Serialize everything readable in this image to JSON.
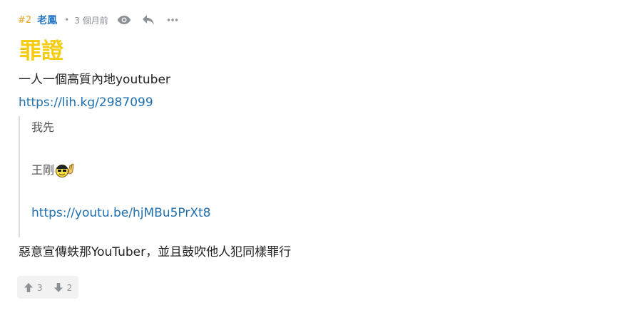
{
  "post": {
    "floor": "#2",
    "author": "老鳳",
    "separator": "•",
    "time": "3 個月前",
    "title": "罪證",
    "body_line1": "一人一個高質內地youtuber",
    "link1": "https://lih.kg/2987099",
    "quote": {
      "line1": "我先",
      "line2": "王剛",
      "link": "https://youtu.be/hjMBu5PrXt8"
    },
    "comment": "惡意宣傳蛈那YouTuber，並且鼓吹他人犯同樣罪行"
  },
  "votes": {
    "up": "3",
    "down": "2"
  },
  "icons": {
    "view": "eye-icon",
    "reply": "reply-icon",
    "more": "more-icon",
    "up": "arrow-up-icon",
    "down": "arrow-down-icon",
    "emoji": "rock-on-emoji-icon"
  },
  "colors": {
    "floor": "#e8a21a",
    "author": "#2a78c2",
    "title": "#f4cd14",
    "link": "#1f6fae"
  }
}
